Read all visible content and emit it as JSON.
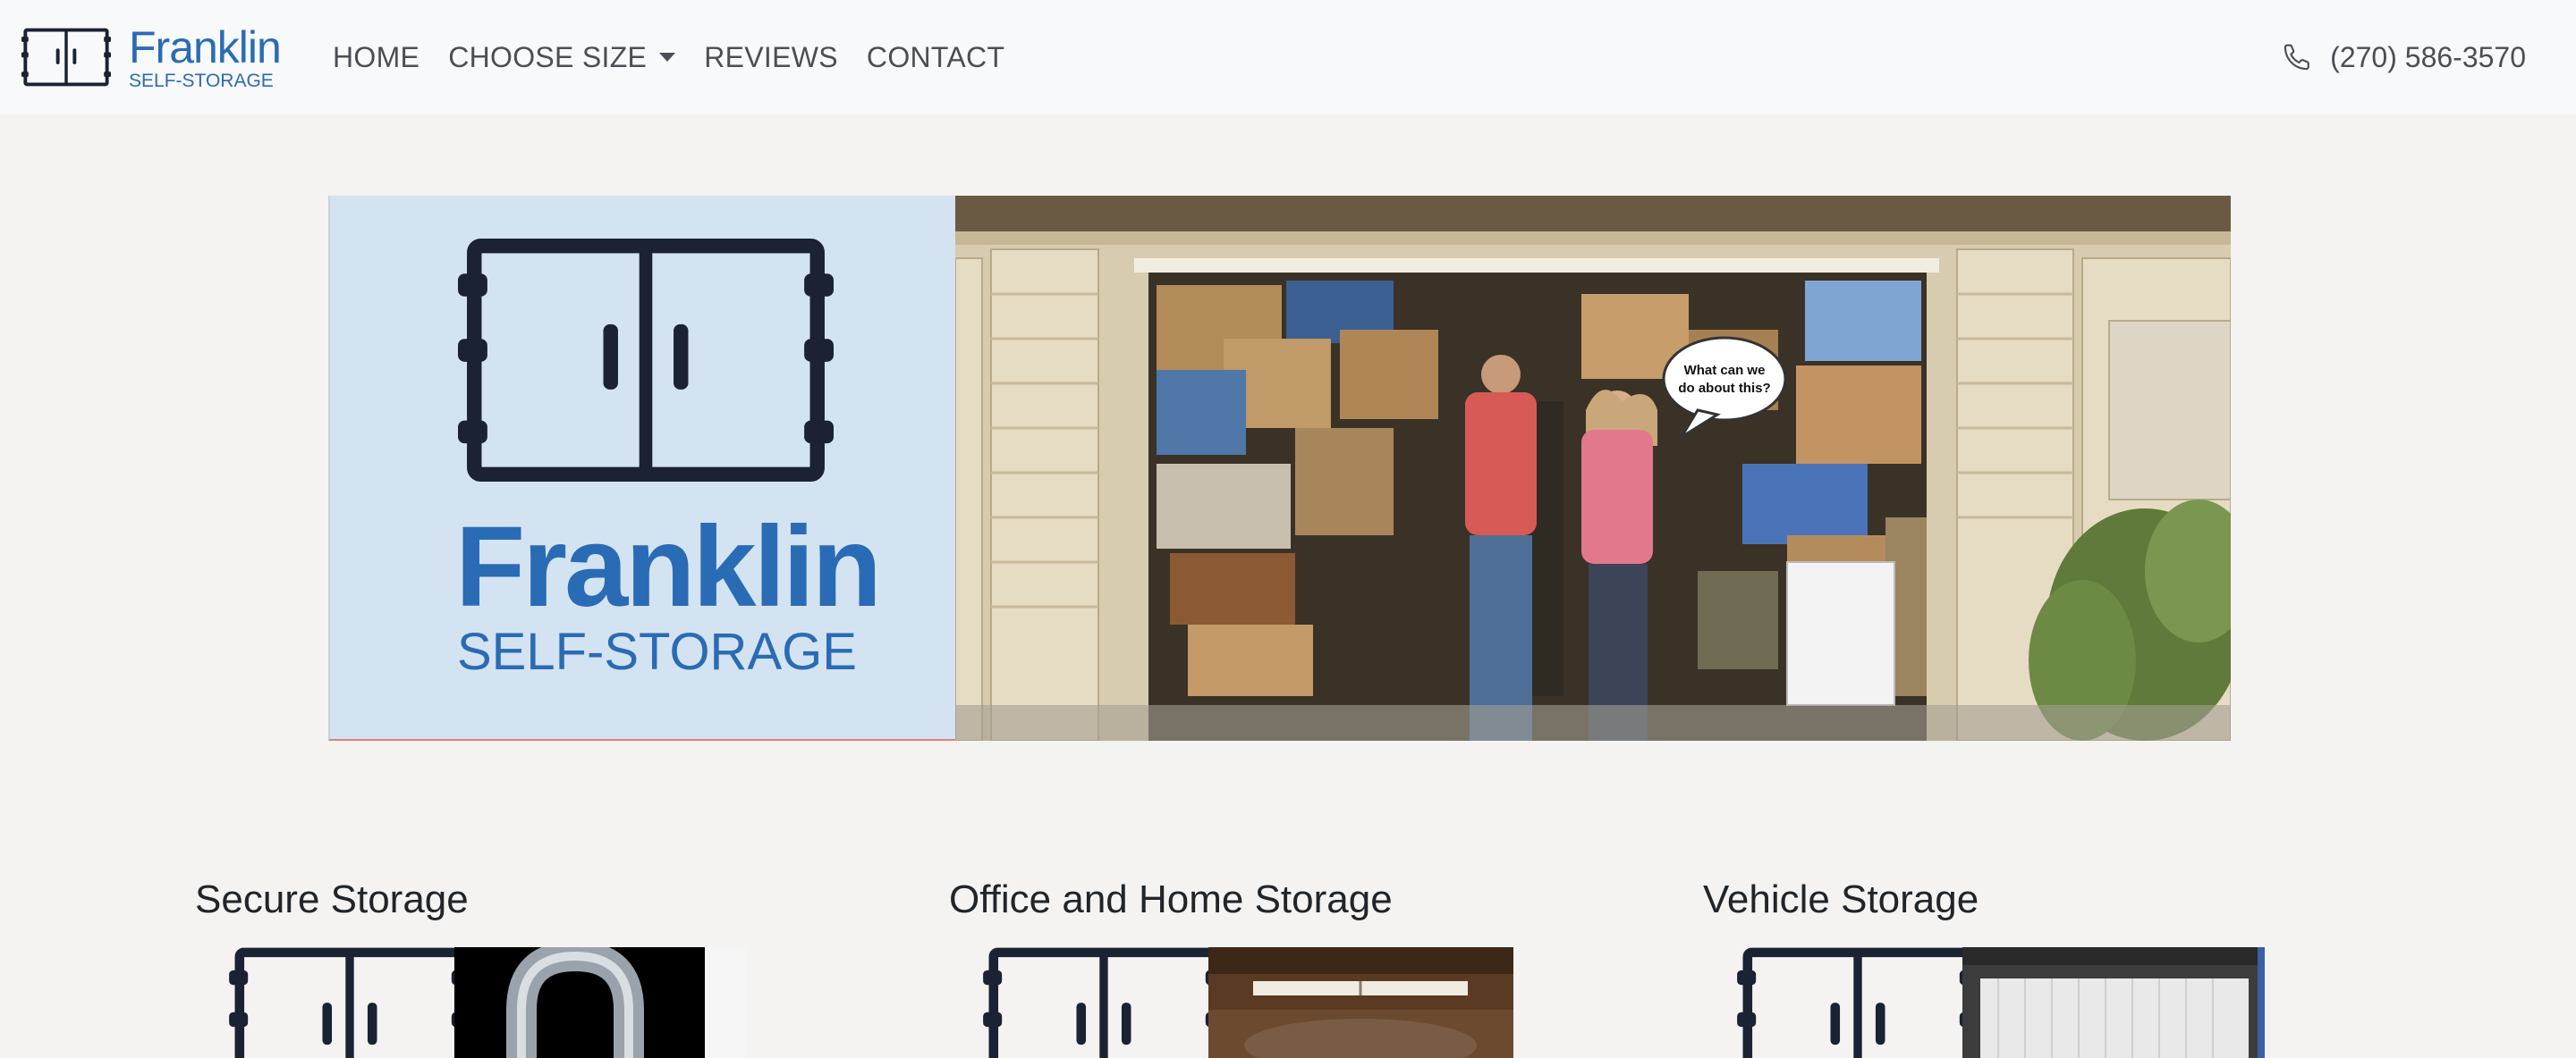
{
  "brand": {
    "name": "Franklin",
    "sub": "SELF-STORAGE",
    "color": "#2a6bb5"
  },
  "nav": {
    "items": [
      {
        "label": "HOME"
      },
      {
        "label": "CHOOSE SIZE"
      },
      {
        "label": "REVIEWS"
      },
      {
        "label": "CONTACT"
      }
    ],
    "phone": "(270) 586-3570",
    "phone_icon": "phone-icon"
  },
  "hero": {
    "name": "Franklin",
    "sub": "SELF-STORAGE",
    "speech_bubble": "What can we do about this?"
  },
  "features": [
    {
      "title": "Secure Storage"
    },
    {
      "title": "Office and Home Storage"
    },
    {
      "title": "Vehicle Storage"
    }
  ],
  "colors": {
    "navbar_bg": "#f8f9fa",
    "page_bg": "#f4f3f1",
    "logo_dark": "#1a2233",
    "brand_blue": "#2a6bb5"
  }
}
